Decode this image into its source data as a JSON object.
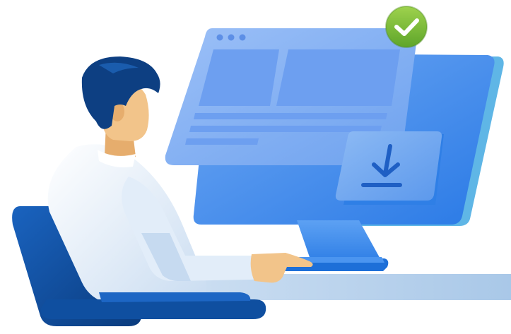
{
  "illustration": {
    "subject": "person-at-computer-download-complete",
    "colors": {
      "monitor_blue": "#3d8af0",
      "monitor_light": "#8eb8f6",
      "monitor_panel": "#5e9bf0",
      "desk": "#b4cfea",
      "hair": "#0d3f82",
      "skin": "#f2c48a",
      "shirt": "#ecf3fb",
      "chair": "#0f4fa0",
      "check_badge": "#7fbf3a"
    },
    "icons": [
      "check-icon",
      "download-icon"
    ]
  }
}
